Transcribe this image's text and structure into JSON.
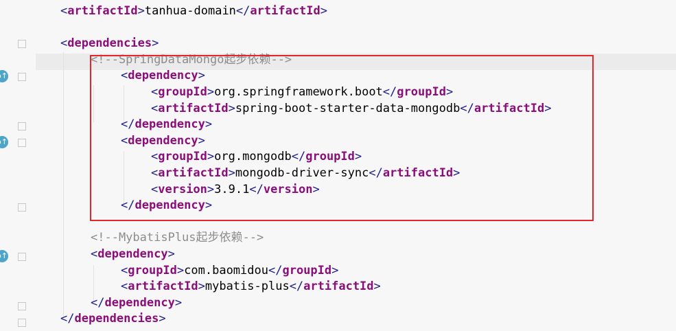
{
  "editor": {
    "lines": [
      {
        "type": "element",
        "tag": "artifactId",
        "text": "tanhua-domain"
      },
      {
        "type": "blank"
      },
      {
        "type": "open",
        "tag": "dependencies"
      },
      {
        "type": "comment",
        "text": "<!--SpringDataMongo起步依赖-->"
      },
      {
        "type": "open",
        "tag": "dependency"
      },
      {
        "type": "element",
        "tag": "groupId",
        "text": "org.springframework.boot"
      },
      {
        "type": "element",
        "tag": "artifactId",
        "text": "spring-boot-starter-data-mongodb"
      },
      {
        "type": "close",
        "tag": "dependency"
      },
      {
        "type": "open",
        "tag": "dependency"
      },
      {
        "type": "element",
        "tag": "groupId",
        "text": "org.mongodb"
      },
      {
        "type": "element",
        "tag": "artifactId",
        "text": "mongodb-driver-sync"
      },
      {
        "type": "element",
        "tag": "version",
        "text": "3.9.1"
      },
      {
        "type": "close",
        "tag": "dependency"
      },
      {
        "type": "blank"
      },
      {
        "type": "comment",
        "text": "<!--MybatisPlus起步依赖-->"
      },
      {
        "type": "open",
        "tag": "dependency"
      },
      {
        "type": "element",
        "tag": "groupId",
        "text": "com.baomidou"
      },
      {
        "type": "element",
        "tag": "artifactId",
        "text": "mybatis-plus"
      },
      {
        "type": "close",
        "tag": "dependency"
      },
      {
        "type": "close",
        "tag": "dependencies"
      }
    ]
  },
  "gutter": {
    "marker_icon": "maven-dependency-icon",
    "marker_glyph": "o↑"
  },
  "colors": {
    "tag": "#8a0e7a",
    "bracket": "#1c1c8c",
    "comment": "#8c8c8c",
    "highlight": "#e8242b",
    "marker": "#4da6c9"
  }
}
